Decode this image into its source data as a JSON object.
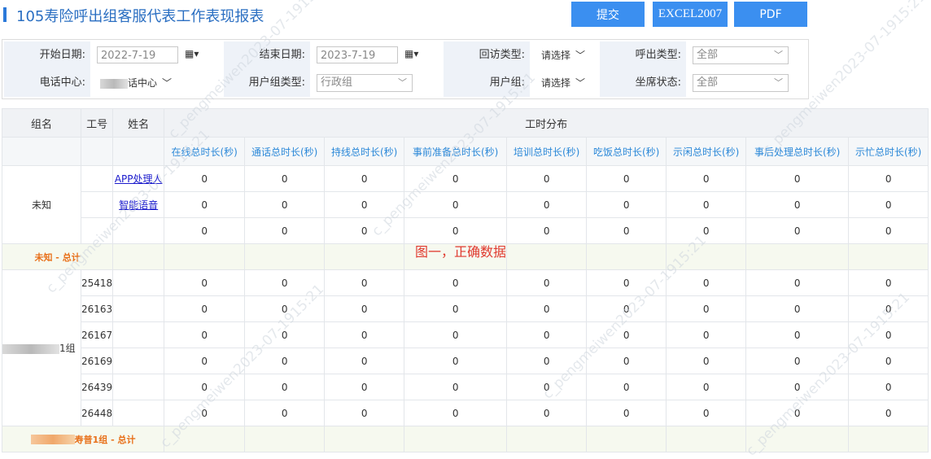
{
  "title": "105寿险呼出组客服代表工作表现报表",
  "buttons": {
    "submit": "提交",
    "excel": "EXCEL2007",
    "pdf": "PDF"
  },
  "filters": {
    "start_date_label": "开始日期:",
    "start_date_value": "2022-7-19",
    "end_date_label": "结束日期:",
    "end_date_value": "2023-7-19",
    "visit_type_label": "回访类型:",
    "visit_type_value": "请选择",
    "call_type_label": "呼出类型:",
    "call_type_value": "全部",
    "call_center_label": "电话中心:",
    "call_center_value": "话中心",
    "user_group_type_label": "用户组类型:",
    "user_group_type_value": "行政组",
    "user_group_label": "用户组:",
    "user_group_value": "请选择",
    "seat_status_label": "坐席状态:",
    "seat_status_value": "全部"
  },
  "table": {
    "headers": {
      "group": "组名",
      "id": "工号",
      "name": "姓名",
      "dist": "工时分布"
    },
    "columns": [
      "在线总时长(秒)",
      "通话总时长(秒)",
      "持线总时长(秒)",
      "事前准备总时长(秒)",
      "培训总时长(秒)",
      "吃饭总时长(秒)",
      "示闲总时长(秒)",
      "事后处理总时长(秒)",
      "示忙总时长(秒)"
    ],
    "group1": {
      "name": "未知",
      "rows": [
        {
          "name": "APP处理人",
          "values": [
            "0",
            "0",
            "0",
            "0",
            "0",
            "0",
            "0",
            "0",
            "0"
          ]
        },
        {
          "name": "智能语音",
          "values": [
            "0",
            "0",
            "0",
            "0",
            "0",
            "0",
            "0",
            "0",
            "0"
          ]
        },
        {
          "name": "",
          "values": [
            "0",
            "0",
            "0",
            "0",
            "0",
            "0",
            "0",
            "0",
            "0"
          ]
        }
      ],
      "subtotal": "未知 - 总计"
    },
    "group2": {
      "name": "1组",
      "rows": [
        {
          "id": "25418",
          "values": [
            "0",
            "0",
            "0",
            "0",
            "0",
            "0",
            "0",
            "0",
            "0"
          ]
        },
        {
          "id": "26163",
          "values": [
            "0",
            "0",
            "0",
            "0",
            "0",
            "0",
            "0",
            "0",
            "0"
          ]
        },
        {
          "id": "26167",
          "values": [
            "0",
            "0",
            "0",
            "0",
            "0",
            "0",
            "0",
            "0",
            "0"
          ]
        },
        {
          "id": "26169",
          "values": [
            "0",
            "0",
            "0",
            "0",
            "0",
            "0",
            "0",
            "0",
            "0"
          ]
        },
        {
          "id": "26439",
          "values": [
            "0",
            "0",
            "0",
            "0",
            "0",
            "0",
            "0",
            "0",
            "0"
          ]
        },
        {
          "id": "26448",
          "values": [
            "0",
            "0",
            "0",
            "0",
            "0",
            "0",
            "0",
            "0",
            "0"
          ]
        }
      ],
      "subtotal": "寿普1组 - 总计"
    }
  },
  "annotation": "图一，正确数据",
  "watermark": "c_pengmeiwen2023-07-1915:21"
}
